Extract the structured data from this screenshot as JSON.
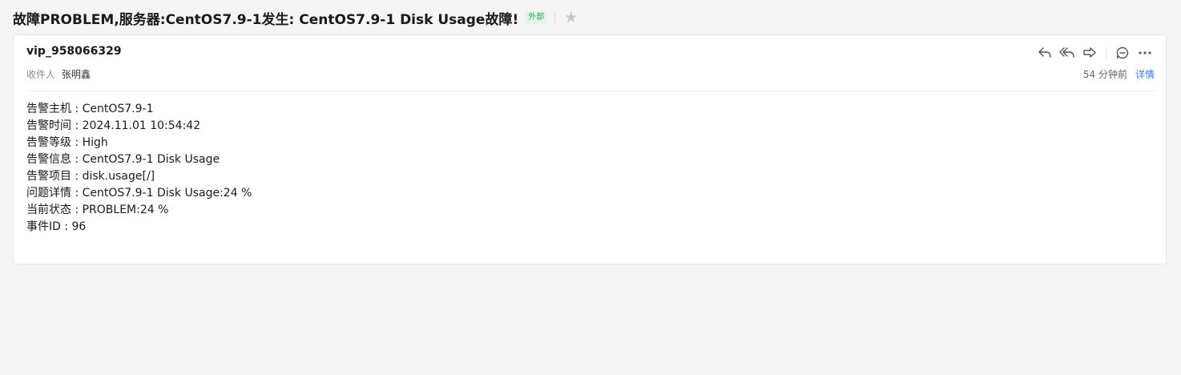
{
  "subject": {
    "title": "故障PROBLEM,服务器:CentOS7.9-1发生: CentOS7.9-1 Disk Usage故障!",
    "tag": "外部",
    "star_icon": "star-icon"
  },
  "header": {
    "sender": "vip_958066329",
    "recipient_label": "收件人",
    "recipient_name": "张明鑫",
    "time_ago": "54 分钟前",
    "details_link": "详情"
  },
  "toolbar": {
    "icons": [
      "reply-icon",
      "reply-all-icon",
      "forward-icon",
      "comment-icon",
      "more-icon"
    ]
  },
  "body": {
    "lines": [
      "告警主机 : CentOS7.9-1",
      "告警时间 : 2024.11.01 10:54:42",
      "告警等级 : High",
      "告警信息 : CentOS7.9-1 Disk Usage",
      "告警项目 : disk.usage[/]",
      "问题详情 : CentOS7.9-1 Disk Usage:24 %",
      "当前状态 : PROBLEM:24 %",
      "事件ID : 96"
    ]
  },
  "colors": {
    "background": "#f5f5f5",
    "tag_green": "#2aa35c",
    "link_blue": "#3b78e7"
  }
}
